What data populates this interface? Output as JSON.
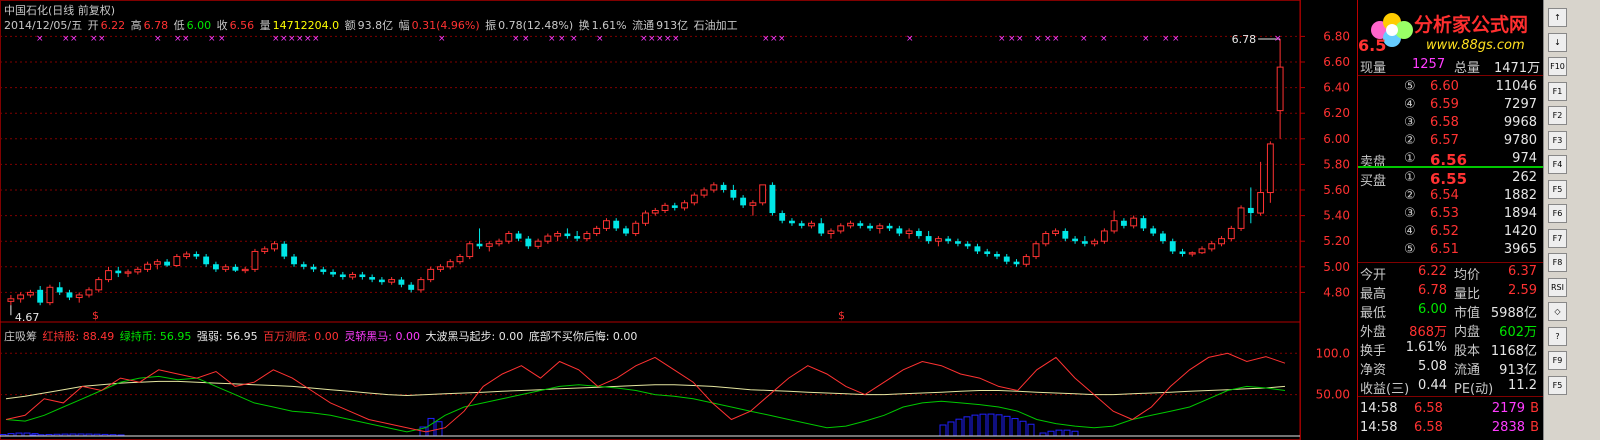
{
  "header": {
    "stock": "中国石化(日线 前复权)",
    "date": "2014/12/05/五",
    "open_label": "开",
    "open": "6.22",
    "high_label": "高",
    "high": "6.78",
    "low_label": "低",
    "low": "6.00",
    "close_label": "收",
    "close": "6.56",
    "vol_label": "量",
    "vol": "14712204.0",
    "amt_label": "额",
    "amt": "93.8亿",
    "chg_label": "幅",
    "chg": "0.31(4.96%)",
    "amp_label": "振",
    "amp": "0.78(12.48%)",
    "turn_label": "换",
    "turn": "1.61%",
    "float_label": "流通",
    "float": "913亿",
    "sector": "石油加工"
  },
  "indicator": {
    "name": "庄吸筹",
    "items": [
      {
        "label": "红持股: 88.49",
        "color": "#ff3232"
      },
      {
        "label": "绿持币: 56.95",
        "color": "#00e600"
      },
      {
        "label": "强弱: 56.95",
        "color": "#e6e6e6"
      },
      {
        "label": "百万测底: 0.00",
        "color": "#ff3232"
      },
      {
        "label": "灵轿黑马: 0.00",
        "color": "#ff3cff"
      },
      {
        "label": "大波黑马起步: 0.00",
        "color": "#e6e6e6"
      },
      {
        "label": "底部不买你后悔: 0.00",
        "color": "#e6e6e6"
      }
    ]
  },
  "price_axis": [
    "6.80",
    "6.60",
    "6.40",
    "6.20",
    "6.00",
    "5.80",
    "5.60",
    "5.40",
    "5.20",
    "5.00",
    "4.80"
  ],
  "ind_axis": [
    "100.0",
    "50.00"
  ],
  "chart_labels": {
    "hi": "6.78",
    "lo": "4.67",
    "sig1": "$",
    "sig2": "$"
  },
  "colors": {
    "up": "#ff3232",
    "down": "#00e6e6",
    "grid": "#800000",
    "ma_fast": "#ff3232",
    "ma_slow": "#00c800",
    "strength": "#e6e6a0",
    "bars": "#2020ff"
  },
  "chart_data": {
    "type": "candlestick",
    "ylim": [
      4.6,
      6.85
    ],
    "candles": [
      [
        4.73,
        4.78,
        4.7,
        4.75
      ],
      [
        4.75,
        4.8,
        4.72,
        4.78
      ],
      [
        4.78,
        4.82,
        4.76,
        4.8
      ],
      [
        4.82,
        4.85,
        4.7,
        4.72
      ],
      [
        4.72,
        4.86,
        4.7,
        4.84
      ],
      [
        4.84,
        4.88,
        4.78,
        4.8
      ],
      [
        4.8,
        4.82,
        4.74,
        4.76
      ],
      [
        4.76,
        4.8,
        4.72,
        4.78
      ],
      [
        4.78,
        4.84,
        4.76,
        4.82
      ],
      [
        4.82,
        4.92,
        4.8,
        4.9
      ],
      [
        4.9,
        5.0,
        4.88,
        4.97
      ],
      [
        4.97,
        5.0,
        4.92,
        4.95
      ],
      [
        4.95,
        4.98,
        4.92,
        4.96
      ],
      [
        4.96,
        5.0,
        4.94,
        4.98
      ],
      [
        4.98,
        5.04,
        4.96,
        5.02
      ],
      [
        5.02,
        5.06,
        4.98,
        5.04
      ],
      [
        5.04,
        5.06,
        5.0,
        5.01
      ],
      [
        5.01,
        5.1,
        5.0,
        5.08
      ],
      [
        5.08,
        5.12,
        5.06,
        5.1
      ],
      [
        5.1,
        5.12,
        5.06,
        5.08
      ],
      [
        5.08,
        5.1,
        5.0,
        5.02
      ],
      [
        5.02,
        5.04,
        4.96,
        4.98
      ],
      [
        4.98,
        5.02,
        4.96,
        5.0
      ],
      [
        5.0,
        5.02,
        4.96,
        4.97
      ],
      [
        4.97,
        5.0,
        4.95,
        4.98
      ],
      [
        4.98,
        5.14,
        4.96,
        5.12
      ],
      [
        5.12,
        5.16,
        5.1,
        5.14
      ],
      [
        5.14,
        5.2,
        5.12,
        5.18
      ],
      [
        5.18,
        5.2,
        5.06,
        5.08
      ],
      [
        5.08,
        5.1,
        5.0,
        5.02
      ],
      [
        5.02,
        5.04,
        4.98,
        5.0
      ],
      [
        5.0,
        5.02,
        4.96,
        4.98
      ],
      [
        4.98,
        5.0,
        4.94,
        4.96
      ],
      [
        4.96,
        4.98,
        4.92,
        4.94
      ],
      [
        4.94,
        4.96,
        4.9,
        4.92
      ],
      [
        4.92,
        4.96,
        4.9,
        4.94
      ],
      [
        4.94,
        4.96,
        4.9,
        4.92
      ],
      [
        4.92,
        4.94,
        4.88,
        4.9
      ],
      [
        4.9,
        4.92,
        4.86,
        4.88
      ],
      [
        4.88,
        4.92,
        4.86,
        4.9
      ],
      [
        4.9,
        4.92,
        4.84,
        4.86
      ],
      [
        4.86,
        4.88,
        4.8,
        4.82
      ],
      [
        4.82,
        4.92,
        4.8,
        4.9
      ],
      [
        4.9,
        5.0,
        4.88,
        4.98
      ],
      [
        4.98,
        5.02,
        4.96,
        5.0
      ],
      [
        5.0,
        5.06,
        4.98,
        5.04
      ],
      [
        5.04,
        5.1,
        5.02,
        5.08
      ],
      [
        5.08,
        5.2,
        5.06,
        5.18
      ],
      [
        5.18,
        5.3,
        5.14,
        5.16
      ],
      [
        5.16,
        5.2,
        5.12,
        5.18
      ],
      [
        5.18,
        5.22,
        5.16,
        5.2
      ],
      [
        5.2,
        5.28,
        5.18,
        5.26
      ],
      [
        5.26,
        5.28,
        5.2,
        5.22
      ],
      [
        5.22,
        5.24,
        5.14,
        5.16
      ],
      [
        5.16,
        5.22,
        5.14,
        5.2
      ],
      [
        5.2,
        5.26,
        5.18,
        5.24
      ],
      [
        5.24,
        5.28,
        5.2,
        5.26
      ],
      [
        5.26,
        5.3,
        5.22,
        5.24
      ],
      [
        5.24,
        5.28,
        5.2,
        5.22
      ],
      [
        5.22,
        5.28,
        5.2,
        5.26
      ],
      [
        5.26,
        5.32,
        5.24,
        5.3
      ],
      [
        5.3,
        5.38,
        5.28,
        5.36
      ],
      [
        5.36,
        5.38,
        5.28,
        5.3
      ],
      [
        5.3,
        5.32,
        5.24,
        5.26
      ],
      [
        5.26,
        5.36,
        5.24,
        5.34
      ],
      [
        5.34,
        5.44,
        5.32,
        5.42
      ],
      [
        5.42,
        5.46,
        5.4,
        5.44
      ],
      [
        5.44,
        5.5,
        5.42,
        5.48
      ],
      [
        5.48,
        5.5,
        5.44,
        5.46
      ],
      [
        5.46,
        5.52,
        5.44,
        5.5
      ],
      [
        5.5,
        5.58,
        5.48,
        5.56
      ],
      [
        5.56,
        5.62,
        5.54,
        5.6
      ],
      [
        5.6,
        5.66,
        5.58,
        5.64
      ],
      [
        5.64,
        5.66,
        5.58,
        5.6
      ],
      [
        5.6,
        5.64,
        5.52,
        5.54
      ],
      [
        5.54,
        5.56,
        5.46,
        5.48
      ],
      [
        5.48,
        5.52,
        5.4,
        5.5
      ],
      [
        5.5,
        5.64,
        5.48,
        5.64
      ],
      [
        5.64,
        5.66,
        5.4,
        5.42
      ],
      [
        5.42,
        5.44,
        5.34,
        5.36
      ],
      [
        5.36,
        5.38,
        5.32,
        5.34
      ],
      [
        5.34,
        5.36,
        5.3,
        5.32
      ],
      [
        5.32,
        5.36,
        5.3,
        5.34
      ],
      [
        5.34,
        5.38,
        5.24,
        5.26
      ],
      [
        5.26,
        5.3,
        5.22,
        5.28
      ],
      [
        5.28,
        5.34,
        5.26,
        5.32
      ],
      [
        5.32,
        5.36,
        5.3,
        5.34
      ],
      [
        5.34,
        5.36,
        5.3,
        5.32
      ],
      [
        5.32,
        5.34,
        5.28,
        5.3
      ],
      [
        5.3,
        5.34,
        5.26,
        5.32
      ],
      [
        5.32,
        5.34,
        5.28,
        5.3
      ],
      [
        5.3,
        5.32,
        5.24,
        5.26
      ],
      [
        5.26,
        5.3,
        5.22,
        5.28
      ],
      [
        5.28,
        5.3,
        5.22,
        5.24
      ],
      [
        5.24,
        5.28,
        5.18,
        5.2
      ],
      [
        5.2,
        5.24,
        5.16,
        5.22
      ],
      [
        5.22,
        5.24,
        5.18,
        5.2
      ],
      [
        5.2,
        5.22,
        5.16,
        5.18
      ],
      [
        5.18,
        5.2,
        5.14,
        5.16
      ],
      [
        5.16,
        5.18,
        5.1,
        5.12
      ],
      [
        5.12,
        5.14,
        5.08,
        5.1
      ],
      [
        5.1,
        5.12,
        5.06,
        5.08
      ],
      [
        5.08,
        5.1,
        5.02,
        5.04
      ],
      [
        5.04,
        5.06,
        5.0,
        5.02
      ],
      [
        5.02,
        5.1,
        5.0,
        5.08
      ],
      [
        5.08,
        5.2,
        5.06,
        5.18
      ],
      [
        5.18,
        5.28,
        5.16,
        5.26
      ],
      [
        5.26,
        5.3,
        5.24,
        5.28
      ],
      [
        5.28,
        5.3,
        5.2,
        5.22
      ],
      [
        5.22,
        5.24,
        5.18,
        5.2
      ],
      [
        5.2,
        5.24,
        5.16,
        5.18
      ],
      [
        5.18,
        5.22,
        5.16,
        5.2
      ],
      [
        5.2,
        5.3,
        5.18,
        5.28
      ],
      [
        5.28,
        5.44,
        5.26,
        5.36
      ],
      [
        5.36,
        5.38,
        5.3,
        5.32
      ],
      [
        5.32,
        5.4,
        5.3,
        5.38
      ],
      [
        5.38,
        5.4,
        5.28,
        5.3
      ],
      [
        5.3,
        5.32,
        5.24,
        5.26
      ],
      [
        5.26,
        5.28,
        5.18,
        5.2
      ],
      [
        5.2,
        5.22,
        5.1,
        5.12
      ],
      [
        5.12,
        5.14,
        5.08,
        5.1
      ],
      [
        5.1,
        5.12,
        5.08,
        5.11
      ],
      [
        5.11,
        5.16,
        5.1,
        5.14
      ],
      [
        5.14,
        5.2,
        5.12,
        5.18
      ],
      [
        5.18,
        5.24,
        5.16,
        5.22
      ],
      [
        5.22,
        5.32,
        5.2,
        5.3
      ],
      [
        5.3,
        5.48,
        5.28,
        5.46
      ],
      [
        5.46,
        5.62,
        5.34,
        5.42
      ],
      [
        5.42,
        5.82,
        5.4,
        5.58
      ],
      [
        5.58,
        5.98,
        5.5,
        5.96
      ],
      [
        6.22,
        6.78,
        6.0,
        6.56
      ]
    ],
    "ind_red": [
      20,
      25,
      45,
      40,
      60,
      55,
      70,
      65,
      80,
      75,
      70,
      78,
      60,
      65,
      80,
      70,
      55,
      40,
      30,
      20,
      15,
      10,
      5,
      10,
      30,
      60,
      75,
      85,
      70,
      90,
      80,
      60,
      70,
      85,
      95,
      80,
      65,
      40,
      20,
      30,
      50,
      70,
      85,
      75,
      60,
      50,
      65,
      80,
      90,
      85,
      75,
      70,
      60,
      55,
      80,
      95,
      70,
      50,
      30,
      20,
      35,
      60,
      80,
      95,
      100,
      90,
      96,
      88
    ],
    "ind_green": [
      20,
      18,
      25,
      35,
      45,
      55,
      65,
      70,
      72,
      68,
      70,
      60,
      50,
      40,
      35,
      30,
      28,
      25,
      20,
      15,
      10,
      5,
      10,
      25,
      35,
      40,
      45,
      50,
      55,
      60,
      62,
      60,
      58,
      55,
      50,
      48,
      45,
      40,
      35,
      30,
      25,
      20,
      15,
      10,
      12,
      18,
      25,
      35,
      40,
      42,
      40,
      38,
      35,
      30,
      20,
      15,
      12,
      10,
      12,
      20,
      25,
      30,
      35,
      45,
      55,
      60,
      58,
      55
    ],
    "ind_strength": [
      45,
      48,
      52,
      56,
      60,
      62,
      64,
      65,
      66,
      66,
      65,
      64,
      63,
      62,
      61,
      60,
      58,
      56,
      54,
      52,
      50,
      49,
      50,
      51,
      52,
      53,
      54,
      55,
      56,
      57,
      58,
      59,
      60,
      61,
      62,
      62,
      61,
      60,
      58,
      56,
      55,
      54,
      53,
      52,
      51,
      50,
      50,
      51,
      52,
      53,
      54,
      55,
      55,
      54,
      53,
      52,
      51,
      50,
      50,
      51,
      52,
      53,
      54,
      55,
      56,
      57,
      58,
      60
    ],
    "ind_ylim": [
      0,
      110
    ]
  },
  "panel": {
    "logo_text": "分析家公式网",
    "logo_url": "www.88gs.com",
    "price": "6.5",
    "now_vol_label": "现量",
    "now_vol": "1257",
    "tot_vol_label": "总量",
    "tot_vol": "1471万",
    "asks": [
      [
        "⑤",
        "6.60",
        "11046"
      ],
      [
        "④",
        "6.59",
        "7297"
      ],
      [
        "③",
        "6.58",
        "9968"
      ],
      [
        "②",
        "6.57",
        "9780"
      ],
      [
        "①",
        "6.56",
        "974"
      ]
    ],
    "ask_label": "卖盘",
    "bid_label": "买盘",
    "bids": [
      [
        "①",
        "6.55",
        "262"
      ],
      [
        "②",
        "6.54",
        "1882"
      ],
      [
        "③",
        "6.53",
        "1894"
      ],
      [
        "④",
        "6.52",
        "1420"
      ],
      [
        "⑤",
        "6.51",
        "3965"
      ]
    ],
    "stats": [
      [
        "今开",
        "6.22",
        "均价",
        "6.37"
      ],
      [
        "最高",
        "6.78",
        "量比",
        "2.59"
      ],
      [
        "最低",
        "6.00",
        "市值",
        "5988亿"
      ],
      [
        "外盘",
        "868万",
        "内盘",
        "602万"
      ],
      [
        "换手",
        "1.61%",
        "股本",
        "1168亿"
      ],
      [
        "净资",
        "5.08",
        "流通",
        "913亿"
      ],
      [
        "收益(三)",
        "0.44",
        "PE(动)",
        "11.2"
      ]
    ],
    "ticks": [
      [
        "14:58",
        "6.58",
        "2179",
        "B"
      ],
      [
        "14:58",
        "6.58",
        "2838",
        "B"
      ]
    ]
  },
  "toolbar": [
    "↑",
    "↓",
    "F10",
    "F1",
    "F2",
    "F3",
    "F4",
    "F5",
    "F6",
    "F7",
    "F8",
    "RSI",
    "◇",
    "?",
    "F9",
    "F5"
  ]
}
